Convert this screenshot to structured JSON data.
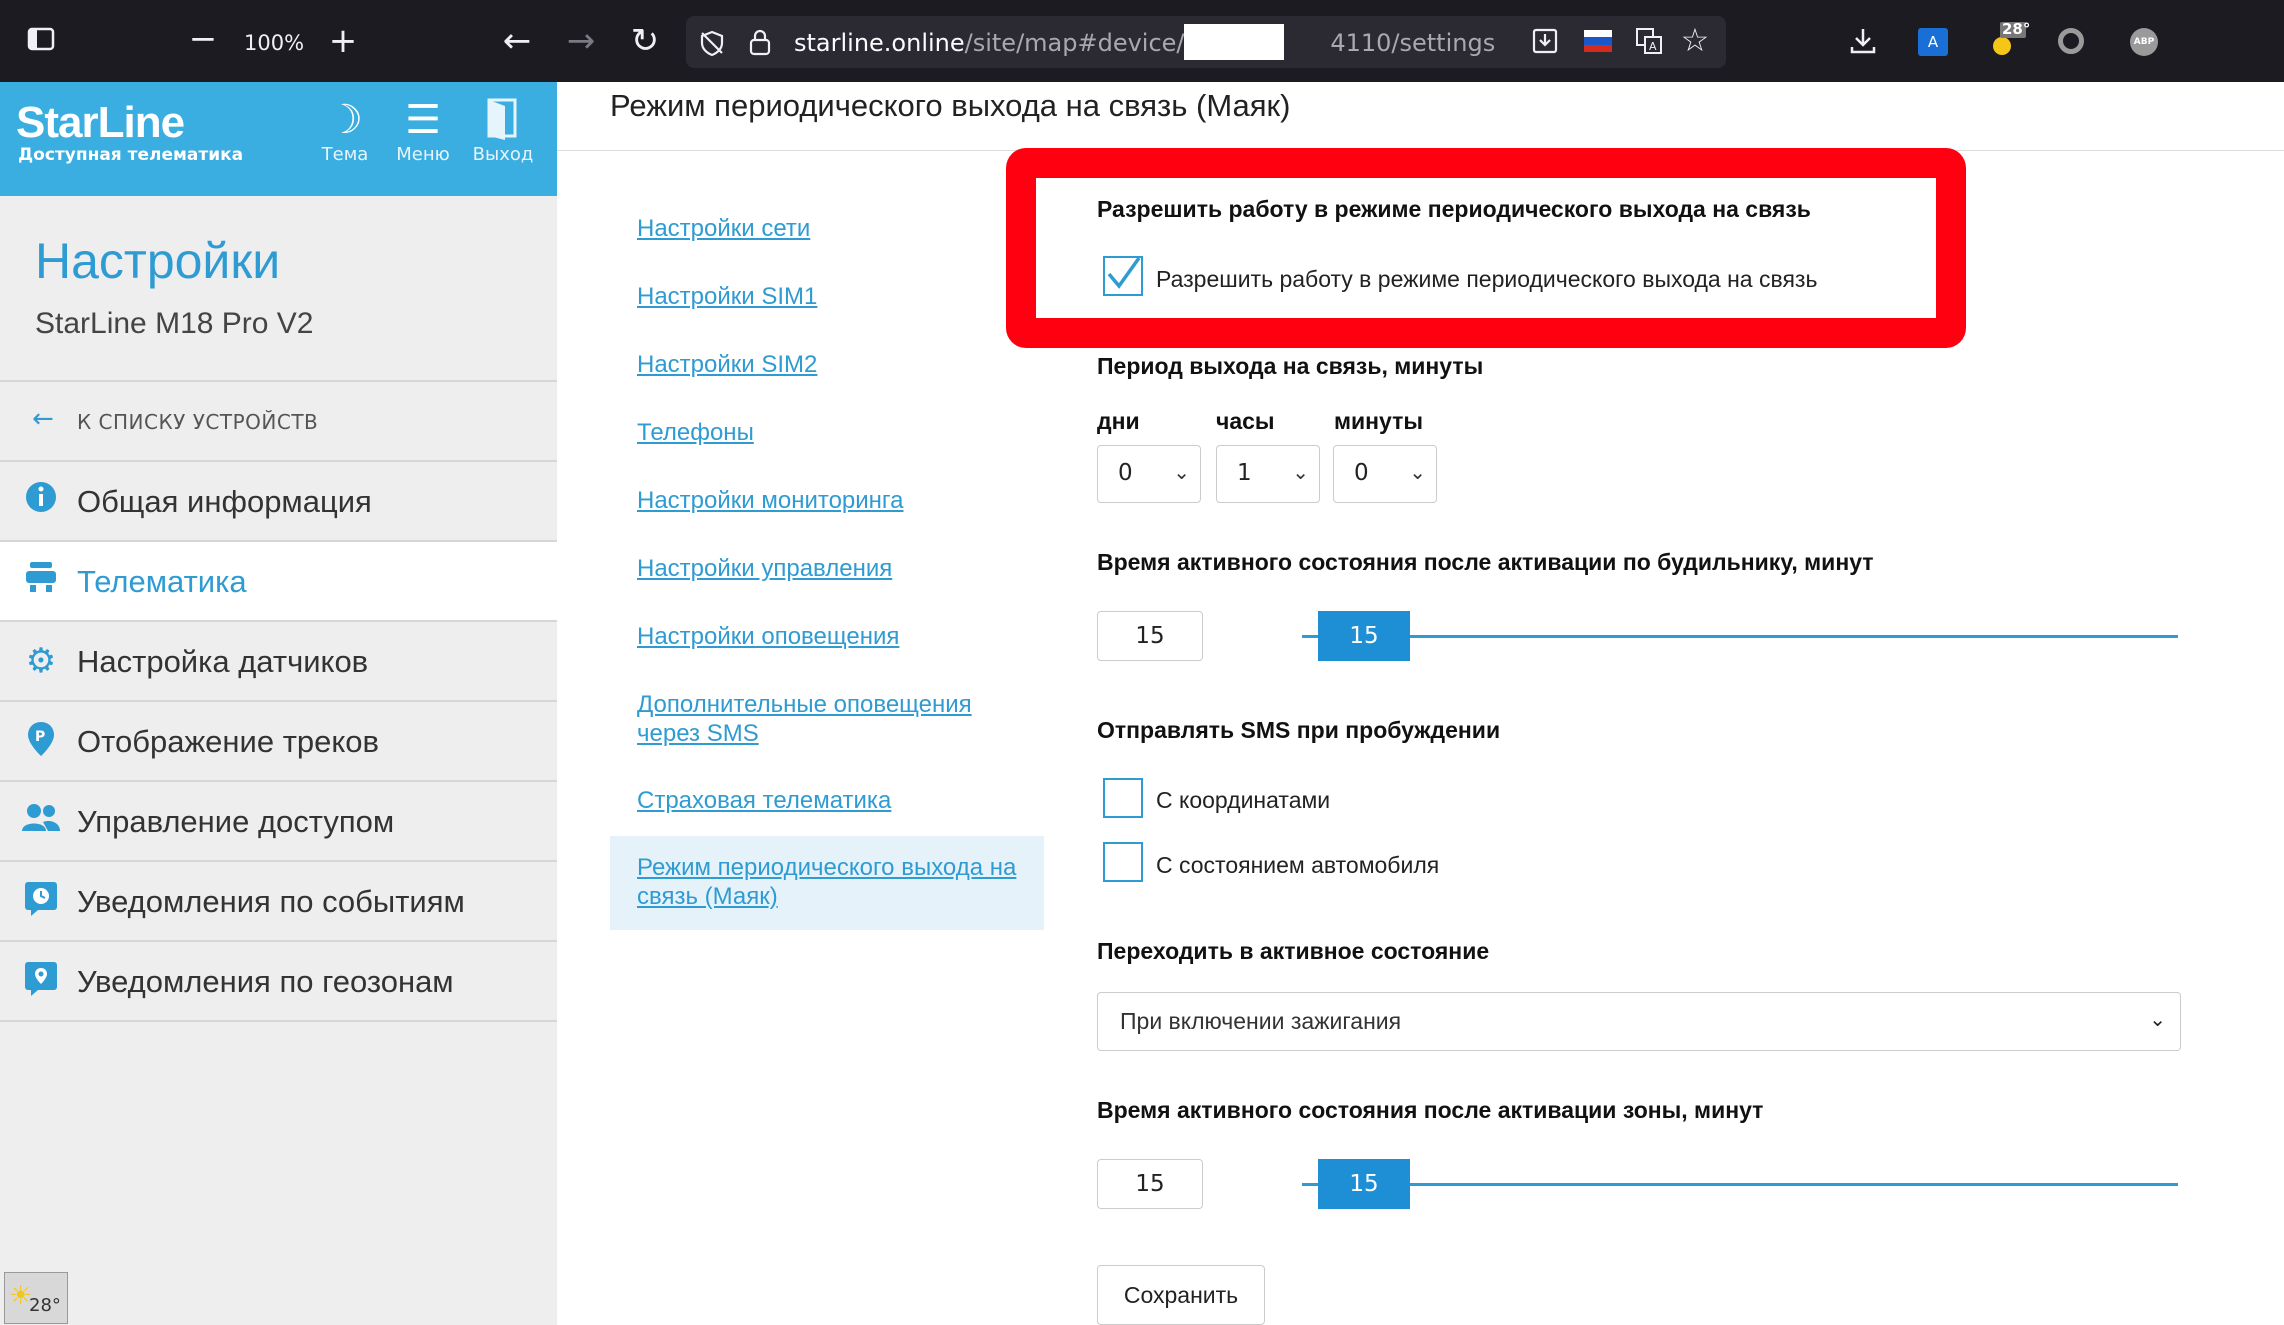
{
  "browser": {
    "zoom": "100%",
    "url_host": "starline.online",
    "url_path_a": "/site/map#device/869",
    "url_path_b": "4110/settings",
    "weather_temp": "28°"
  },
  "sidebar": {
    "logo": "StarLine",
    "logo_sub": "Доступная телематика",
    "theme_label": "Тема",
    "menu_label": "Меню",
    "exit_label": "Выход",
    "title": "Настройки",
    "device": "StarLine M18 Pro V2",
    "back_arrow": "←",
    "back_label": "К СПИСКУ УСТРОЙСТВ",
    "items": [
      {
        "label": "Общая информация",
        "icon": "info-icon"
      },
      {
        "label": "Телематика",
        "icon": "telematics-icon"
      },
      {
        "label": "Настройка датчиков",
        "icon": "gear-icon"
      },
      {
        "label": "Отображение треков",
        "icon": "track-pin-icon"
      },
      {
        "label": "Управление доступом",
        "icon": "users-icon"
      },
      {
        "label": "Уведомления по событиям",
        "icon": "clock-notify-icon"
      },
      {
        "label": "Уведомления по геозонам",
        "icon": "geo-pin-icon"
      }
    ],
    "weather_temp": "28°"
  },
  "main": {
    "title": "Режим периодического выхода на связь (Маяк)",
    "submenu": [
      "Настройки сети",
      "Настройки SIM1",
      "Настройки SIM2",
      "Телефоны",
      "Настройки мониторинга",
      "Настройки управления",
      "Настройки оповещения",
      "Дополнительные оповещения через SMS",
      "Страховая телематика",
      "Режим периодического выхода на связь (Маяк)"
    ],
    "allow_heading": "Разрешить работу в режиме периодического выхода на связь",
    "allow_checkbox_label": "Разрешить работу в режиме периодического выхода на связь",
    "allow_checked": true,
    "period_heading": "Период выхода на связь, минуты",
    "days_label": "дни",
    "hours_label": "часы",
    "minutes_label": "минуты",
    "days_value": "0",
    "hours_value": "1",
    "minutes_value": "0",
    "alarm_heading": "Время активного состояния после активации по будильнику, минут",
    "alarm_value": "15",
    "alarm_slider_value": "15",
    "sms_heading": "Отправлять SMS при пробуждении",
    "sms_coords_label": "С координатами",
    "sms_state_label": "С состоянием автомобиля",
    "active_heading": "Переходить в активное состояние",
    "active_select": "При включении зажигания",
    "zone_heading": "Время активного состояния после активации зоны, минут",
    "zone_value": "15",
    "zone_slider_value": "15",
    "save_label": "Сохранить"
  },
  "colors": {
    "accent": "#2f9bd3",
    "highlight": "#ff0011"
  }
}
